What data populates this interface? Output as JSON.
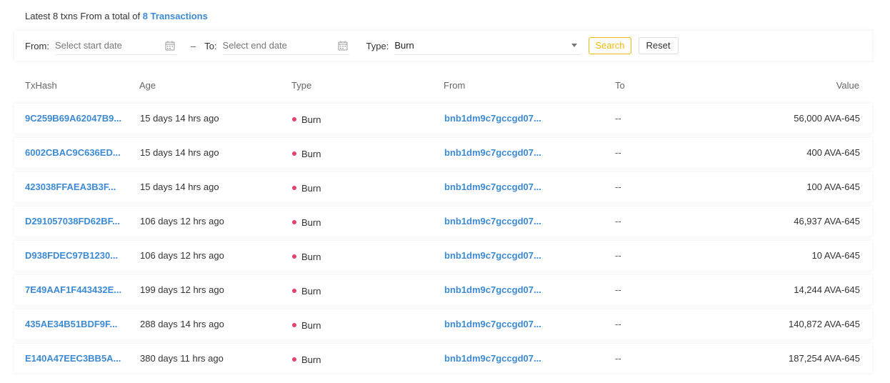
{
  "summary": {
    "prefix": "Latest 8 txns From a total of",
    "link": "8 Transactions"
  },
  "filters": {
    "from_label": "From:",
    "from_placeholder": "Select start date",
    "dash": "–",
    "to_label": "To:",
    "to_placeholder": "Select end date",
    "type_label": "Type:",
    "type_value": "Burn",
    "search_label": "Search",
    "reset_label": "Reset"
  },
  "table": {
    "headers": {
      "txhash": "TxHash",
      "age": "Age",
      "type": "Type",
      "from": "From",
      "to": "To",
      "value": "Value"
    },
    "rows": [
      {
        "hash": "9C259B69A62047B9...",
        "age": "15 days 14 hrs ago",
        "type": "Burn",
        "from": "bnb1dm9c7gccgd07...",
        "to": "--",
        "value": "56,000 AVA-645"
      },
      {
        "hash": "6002CBAC9C636ED...",
        "age": "15 days 14 hrs ago",
        "type": "Burn",
        "from": "bnb1dm9c7gccgd07...",
        "to": "--",
        "value": "400 AVA-645"
      },
      {
        "hash": "423038FFAEA3B3F...",
        "age": "15 days 14 hrs ago",
        "type": "Burn",
        "from": "bnb1dm9c7gccgd07...",
        "to": "--",
        "value": "100 AVA-645"
      },
      {
        "hash": "D291057038FD62BF...",
        "age": "106 days 12 hrs ago",
        "type": "Burn",
        "from": "bnb1dm9c7gccgd07...",
        "to": "--",
        "value": "46,937 AVA-645"
      },
      {
        "hash": "D938FDEC97B1230...",
        "age": "106 days 12 hrs ago",
        "type": "Burn",
        "from": "bnb1dm9c7gccgd07...",
        "to": "--",
        "value": "10 AVA-645"
      },
      {
        "hash": "7E49AAF1F443432E...",
        "age": "199 days 12 hrs ago",
        "type": "Burn",
        "from": "bnb1dm9c7gccgd07...",
        "to": "--",
        "value": "14,244 AVA-645"
      },
      {
        "hash": "435AE34B51BDF9F...",
        "age": "288 days 14 hrs ago",
        "type": "Burn",
        "from": "bnb1dm9c7gccgd07...",
        "to": "--",
        "value": "140,872 AVA-645"
      },
      {
        "hash": "E140A47EEC3BB5A...",
        "age": "380 days 11 hrs ago",
        "type": "Burn",
        "from": "bnb1dm9c7gccgd07...",
        "to": "--",
        "value": "187,254 AVA-645"
      }
    ]
  },
  "colors": {
    "link": "#3c8ad6",
    "accent": "#f0b90b",
    "burn_dot": "#e5416b"
  }
}
